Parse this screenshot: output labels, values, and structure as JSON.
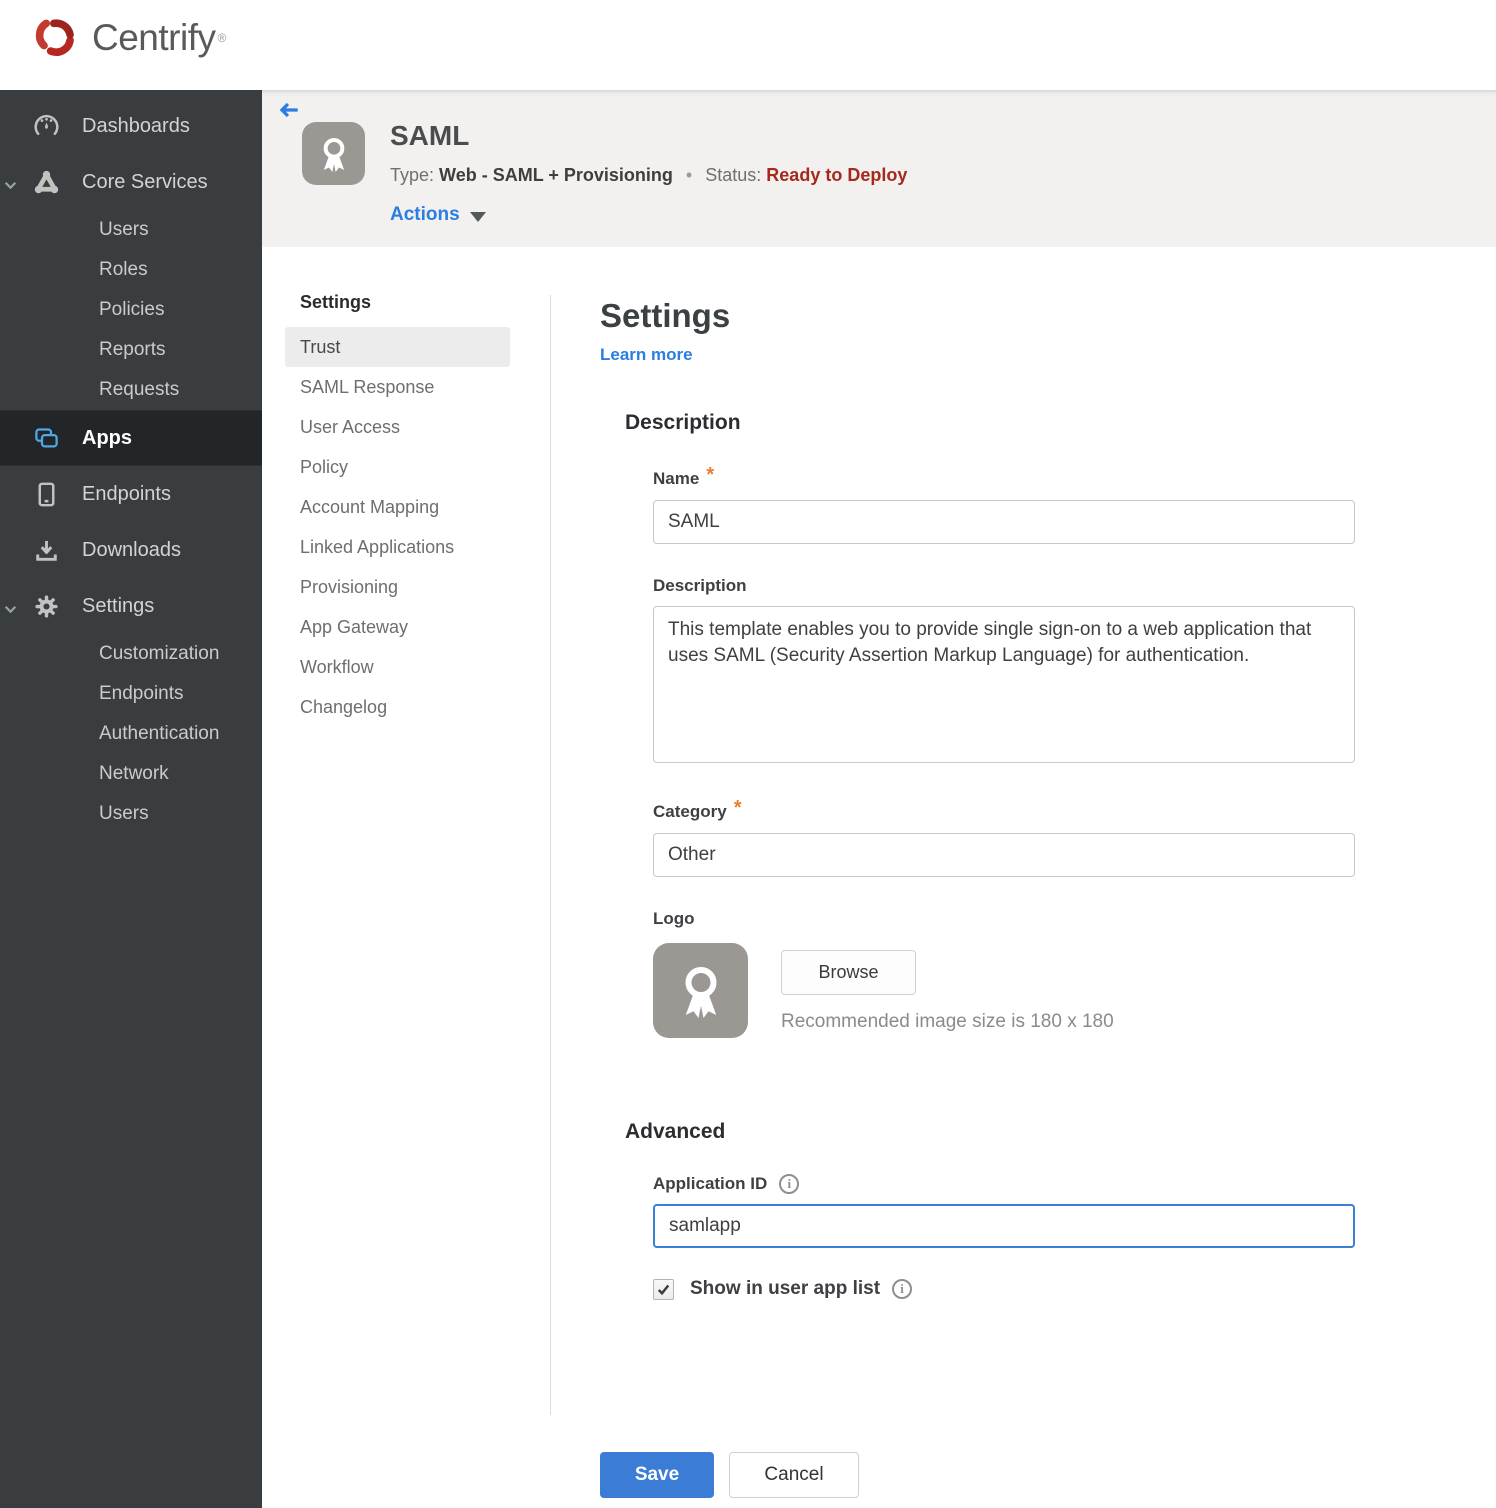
{
  "brand": {
    "name": "Centrify",
    "mark": "®",
    "logo_red": "#b5271f"
  },
  "sidebar": {
    "accent_color": "#4fa8e8",
    "items": [
      {
        "label": "Dashboards",
        "icon": "gauge-icon"
      },
      {
        "label": "Core Services",
        "icon": "network-icon",
        "expanded": true
      },
      {
        "label": "Users"
      },
      {
        "label": "Roles"
      },
      {
        "label": "Policies"
      },
      {
        "label": "Reports"
      },
      {
        "label": "Requests"
      },
      {
        "label": "Apps",
        "icon": "apps-icon",
        "active": true
      },
      {
        "label": "Endpoints",
        "icon": "device-icon"
      },
      {
        "label": "Downloads",
        "icon": "download-icon"
      },
      {
        "label": "Settings",
        "icon": "gear-icon",
        "expanded": true
      },
      {
        "label": "Customization"
      },
      {
        "label": "Endpoints"
      },
      {
        "label": "Authentication"
      },
      {
        "label": "Network"
      },
      {
        "label": "Users"
      }
    ]
  },
  "header": {
    "app_title": "SAML",
    "type_label": "Type:",
    "type_value": "Web - SAML + Provisioning",
    "separator": "•",
    "status_label": "Status:",
    "status_value": "Ready to Deploy",
    "status_color": "#a5291d",
    "actions_label": "Actions"
  },
  "subnav": {
    "title": "Settings",
    "items": [
      {
        "label": "Trust",
        "active": true
      },
      {
        "label": "SAML Response"
      },
      {
        "label": "User Access"
      },
      {
        "label": "Policy"
      },
      {
        "label": "Account Mapping"
      },
      {
        "label": "Linked Applications"
      },
      {
        "label": "Provisioning"
      },
      {
        "label": "App Gateway"
      },
      {
        "label": "Workflow"
      },
      {
        "label": "Changelog"
      }
    ]
  },
  "main": {
    "title": "Settings",
    "learn_more": "Learn more",
    "required_mark": "*",
    "description_section": {
      "title": "Description",
      "name_label": "Name",
      "name_value": "SAML",
      "description_label": "Description",
      "description_value": "This template enables you to provide single sign-on to a web application that uses SAML (Security Assertion Markup Language) for authentication.",
      "category_label": "Category",
      "category_value": "Other",
      "logo_label": "Logo",
      "browse_label": "Browse",
      "logo_hint": "Recommended image size is 180 x 180"
    },
    "advanced_section": {
      "title": "Advanced",
      "application_id_label": "Application ID",
      "application_id_value": "samlapp",
      "show_label": "Show in user app list",
      "checkbox_checked": true
    },
    "footer": {
      "save_label": "Save",
      "cancel_label": "Cancel"
    }
  }
}
